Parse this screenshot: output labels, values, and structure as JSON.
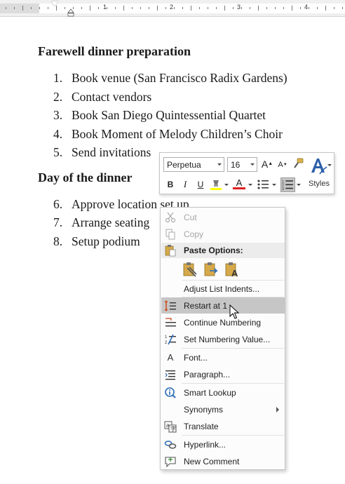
{
  "ruler": {
    "numbers": [
      "1",
      "2",
      "3",
      "4"
    ]
  },
  "document": {
    "heading1": "Farewell dinner preparation",
    "list1": [
      {
        "num": "1.",
        "text": "Book venue (San Francisco Radix Gardens)"
      },
      {
        "num": "2.",
        "text": "Contact vendors"
      },
      {
        "num": "3.",
        "text": "Book San Diego Quintessential Quartet"
      },
      {
        "num": "4.",
        "text": "Book Moment of Melody Children’s Choir"
      },
      {
        "num": "5.",
        "text": "Send invitations"
      }
    ],
    "heading2": "Day of the dinner",
    "list2": [
      {
        "num": "6.",
        "text": "Approve location set up"
      },
      {
        "num": "7.",
        "text": "Arrange seating"
      },
      {
        "num": "8.",
        "text": "Setup podium"
      }
    ]
  },
  "mini_toolbar": {
    "font_name": "Perpetua",
    "font_size": "16",
    "grow_font": "A",
    "shrink_font": "A",
    "bold": "B",
    "italic": "I",
    "underline": "U",
    "font_color": "A",
    "styles_label": "Styles",
    "highlight_color": "#ffff00",
    "font_color_value": "#e02020",
    "styles_color": "#2b5fa8"
  },
  "context_menu": {
    "cut": "Cut",
    "copy": "Copy",
    "paste_options": "Paste Options:",
    "adjust_list_indents": "Adjust List Indents...",
    "restart_at_1": "Restart at 1",
    "continue_numbering": "Continue Numbering",
    "set_numbering_value": "Set Numbering Value...",
    "font": "Font...",
    "paragraph": "Paragraph...",
    "smart_lookup": "Smart Lookup",
    "synonyms": "Synonyms",
    "translate": "Translate",
    "hyperlink": "Hyperlink...",
    "new_comment": "New Comment"
  }
}
